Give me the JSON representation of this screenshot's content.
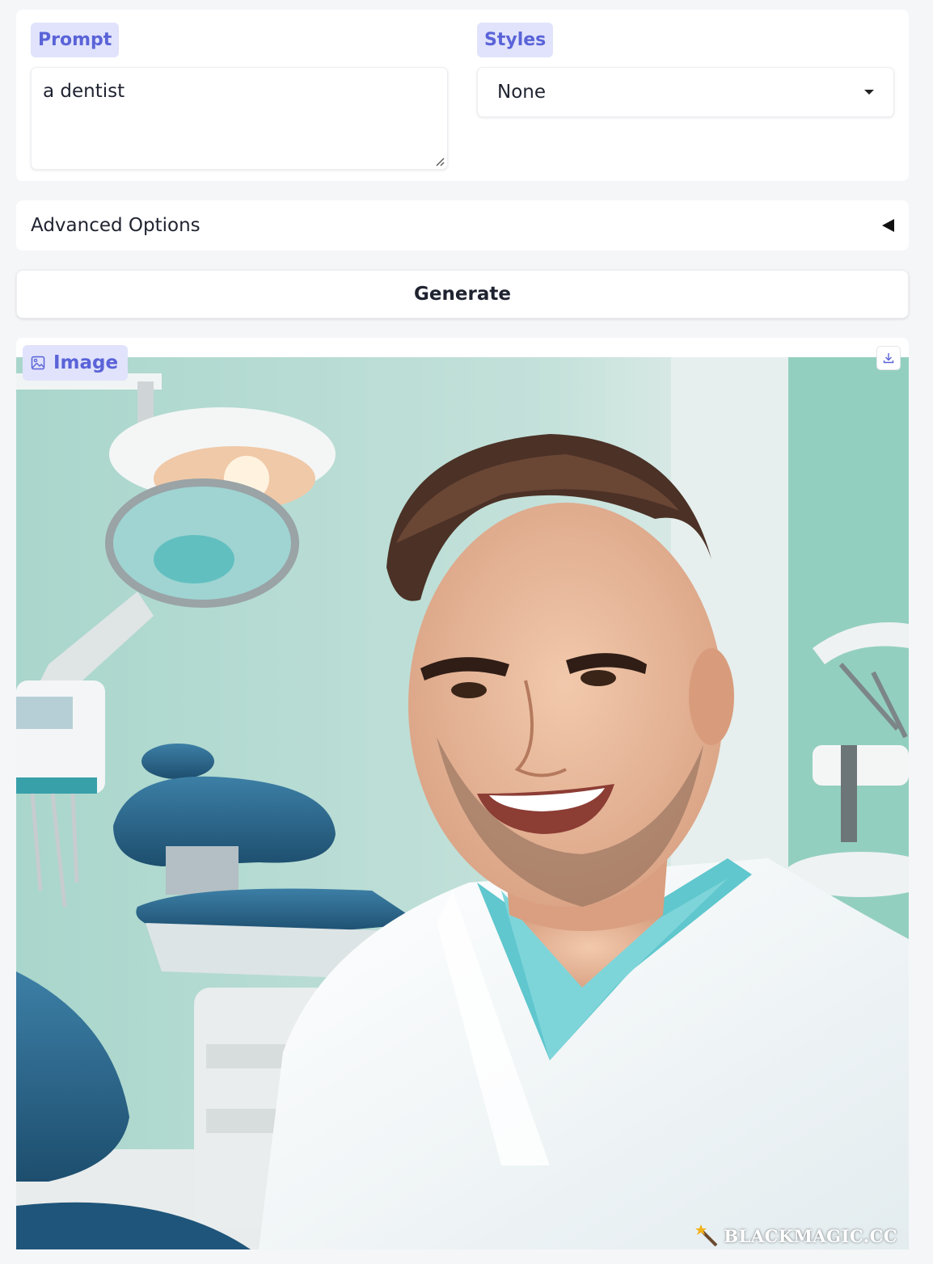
{
  "prompt": {
    "label": "Prompt",
    "value": "a dentist"
  },
  "styles": {
    "label": "Styles",
    "selected": "None"
  },
  "advanced": {
    "label": "Advanced Options"
  },
  "generate": {
    "label": "Generate"
  },
  "output": {
    "label": "Image",
    "watermark": "BLACKMAGIC.CC",
    "description_icon": "image-icon",
    "download_icon": "download-icon"
  },
  "colors": {
    "accent": "#5a63d8",
    "chip_bg": "#e0e3fb",
    "page_bg": "#f5f6f8"
  }
}
